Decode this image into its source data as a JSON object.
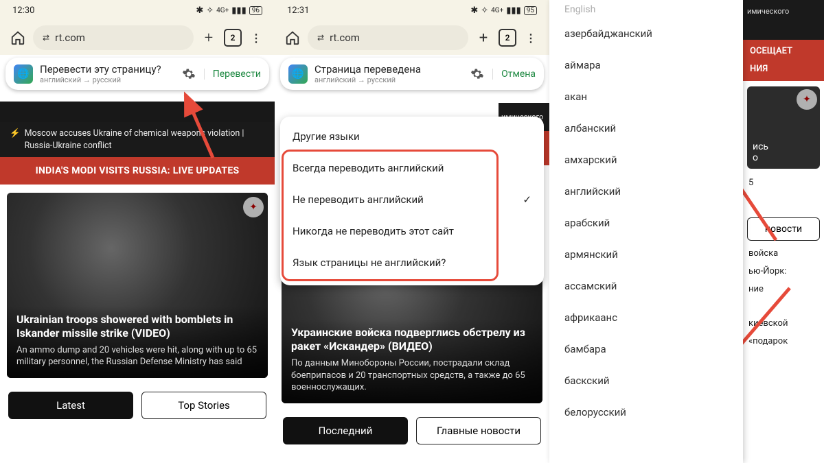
{
  "col1": {
    "status": {
      "time": "12:30",
      "battery": "96"
    },
    "url": "rt.com",
    "tabs": "2",
    "translate": {
      "title": "Перевести эту страницу?",
      "sub": "английский → русский",
      "action": "Перевести"
    },
    "ticker": "Moscow accuses Ukraine of chemical weapons violation | Russia-Ukraine conflict",
    "banner": "INDIA'S MODI VISITS RUSSIA: LIVE UPDATES",
    "card": {
      "h": "Ukrainian troops showered with bomblets in Iskander missile strike (VIDEO)",
      "p": "An ammo dump and 20 vehicles were hit, along with up to 65 military personnel, the Russian Defense Ministry has said"
    },
    "tab1": "Latest",
    "tab2": "Top Stories"
  },
  "col2": {
    "status": {
      "time": "12:31",
      "battery": "95"
    },
    "url": "rt.com",
    "tabs": "2",
    "translate": {
      "title": "Страница переведена",
      "sub": "английский → русский",
      "action": "Отмена"
    },
    "menu": {
      "i0": "Другие языки",
      "i1": "Всегда переводить английский",
      "i2": "Не переводить английский",
      "i3": "Никогда не переводить этот сайт",
      "i4": "Язык страницы не английский?"
    },
    "rb1": "имического",
    "rb2": "ОСЕЩАЕТ",
    "rb3": "НИЯ",
    "card": {
      "h": "Украинские войска подверглись обстрелу из ракет «Искандер» (ВИДЕО)",
      "p": "По данным Минобороны России, пострадали склад боеприпасов и 20 транспортных средств, а также до 65 военнослужащих."
    },
    "tab1": "Последний",
    "tab2": "Главные новости"
  },
  "col3": {
    "top": "English",
    "langs": [
      "азербайджанский",
      "аймара",
      "акан",
      "албанский",
      "амхарский",
      "английский",
      "арабский",
      "армянский",
      "ассамский",
      "африкаанс",
      "бамбара",
      "баскский",
      "белорусский"
    ],
    "r": {
      "dark": "имического",
      "red1": "ОСЕЩАЕТ",
      "red2": "НИЯ",
      "card1": "ись",
      "card1b": "о",
      "num": "5",
      "tab": "новости",
      "t1": "войска",
      "t2": "ью-Йорк:",
      "t3": "ние",
      "t4": "киевской",
      "t5": "«подарок"
    }
  }
}
